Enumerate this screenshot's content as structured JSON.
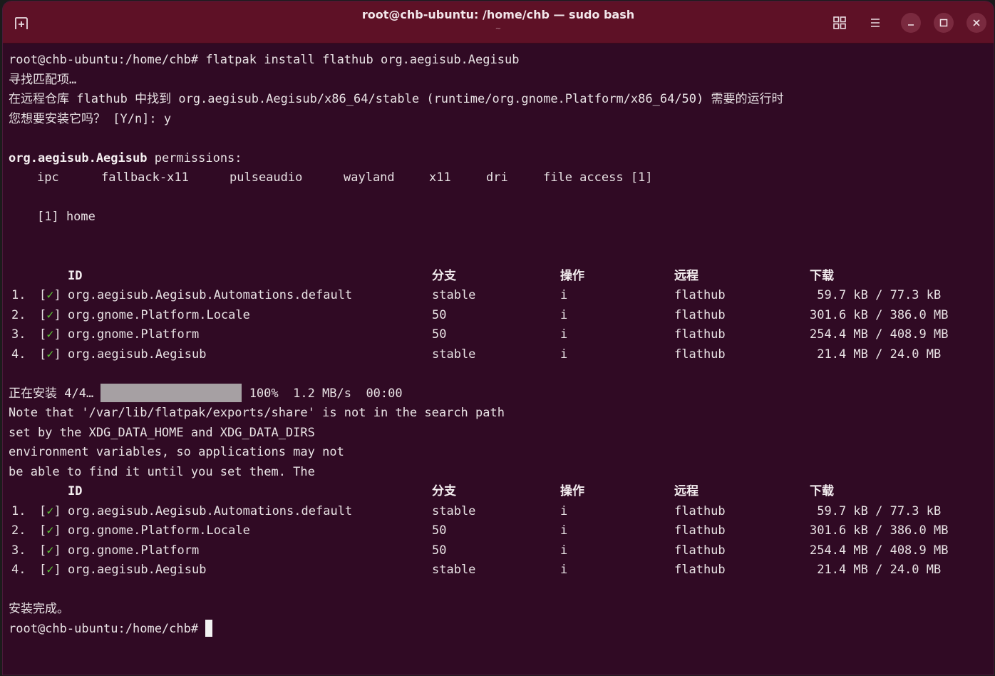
{
  "window": {
    "title": "root@chb-ubuntu: /home/chb — sudo bash",
    "subtitle": "~"
  },
  "terminal": {
    "cmd_prompt": "root@chb-ubuntu:/home/chb# flatpak install flathub org.aegisub.Aegisub",
    "searching": "寻找匹配项…",
    "runtime_found": "在远程仓库 flathub 中找到 org.aegisub.Aegisub/x86_64/stable (runtime/org.gnome.Platform/x86_64/50) 需要的运行时",
    "confirm": "您想要安装它吗？ [Y/n]: y",
    "perm_app": "org.aegisub.Aegisub",
    "perm_suffix": " permissions:",
    "permissions": [
      "ipc",
      "fallback-x11",
      "pulseaudio",
      "wayland",
      "x11",
      "dri",
      "file access [1]"
    ],
    "perm_note": "[1] home",
    "headers": {
      "id": "ID",
      "branch": "分支",
      "op": "操作",
      "remote": "远程",
      "download": "下载"
    },
    "rows": [
      {
        "num": "1.",
        "check": "✓",
        "id": "org.aegisub.Aegisub.Automations.default",
        "branch": "stable",
        "op": "i",
        "remote": "flathub",
        "download": " 59.7 kB / 77.3 kB"
      },
      {
        "num": "2.",
        "check": "✓",
        "id": "org.gnome.Platform.Locale",
        "branch": "50",
        "op": "i",
        "remote": "flathub",
        "download": "301.6 kB / 386.0 MB"
      },
      {
        "num": "3.",
        "check": "✓",
        "id": "org.gnome.Platform",
        "branch": "50",
        "op": "i",
        "remote": "flathub",
        "download": "254.4 MB / 408.9 MB"
      },
      {
        "num": "4.",
        "check": "✓",
        "id": "org.aegisub.Aegisub",
        "branch": "stable",
        "op": "i",
        "remote": "flathub",
        "download": " 21.4 MB / 24.0 MB"
      }
    ],
    "installing_label": "正在安装 4/4…",
    "progress_percent": 100,
    "progress_text": "100%  1.2 MB/s  00:00",
    "note_lines": [
      "Note that '/var/lib/flatpak/exports/share' is not in the search path",
      "set by the XDG_DATA_HOME and XDG_DATA_DIRS",
      "environment variables, so applications may not",
      "be able to find it until you set them. The"
    ],
    "done": "安装完成。",
    "final_prompt": "root@chb-ubuntu:/home/chb# "
  },
  "colors": {
    "background": "#300a24",
    "titlebar": "#5e1126",
    "check": "#5bc236"
  }
}
